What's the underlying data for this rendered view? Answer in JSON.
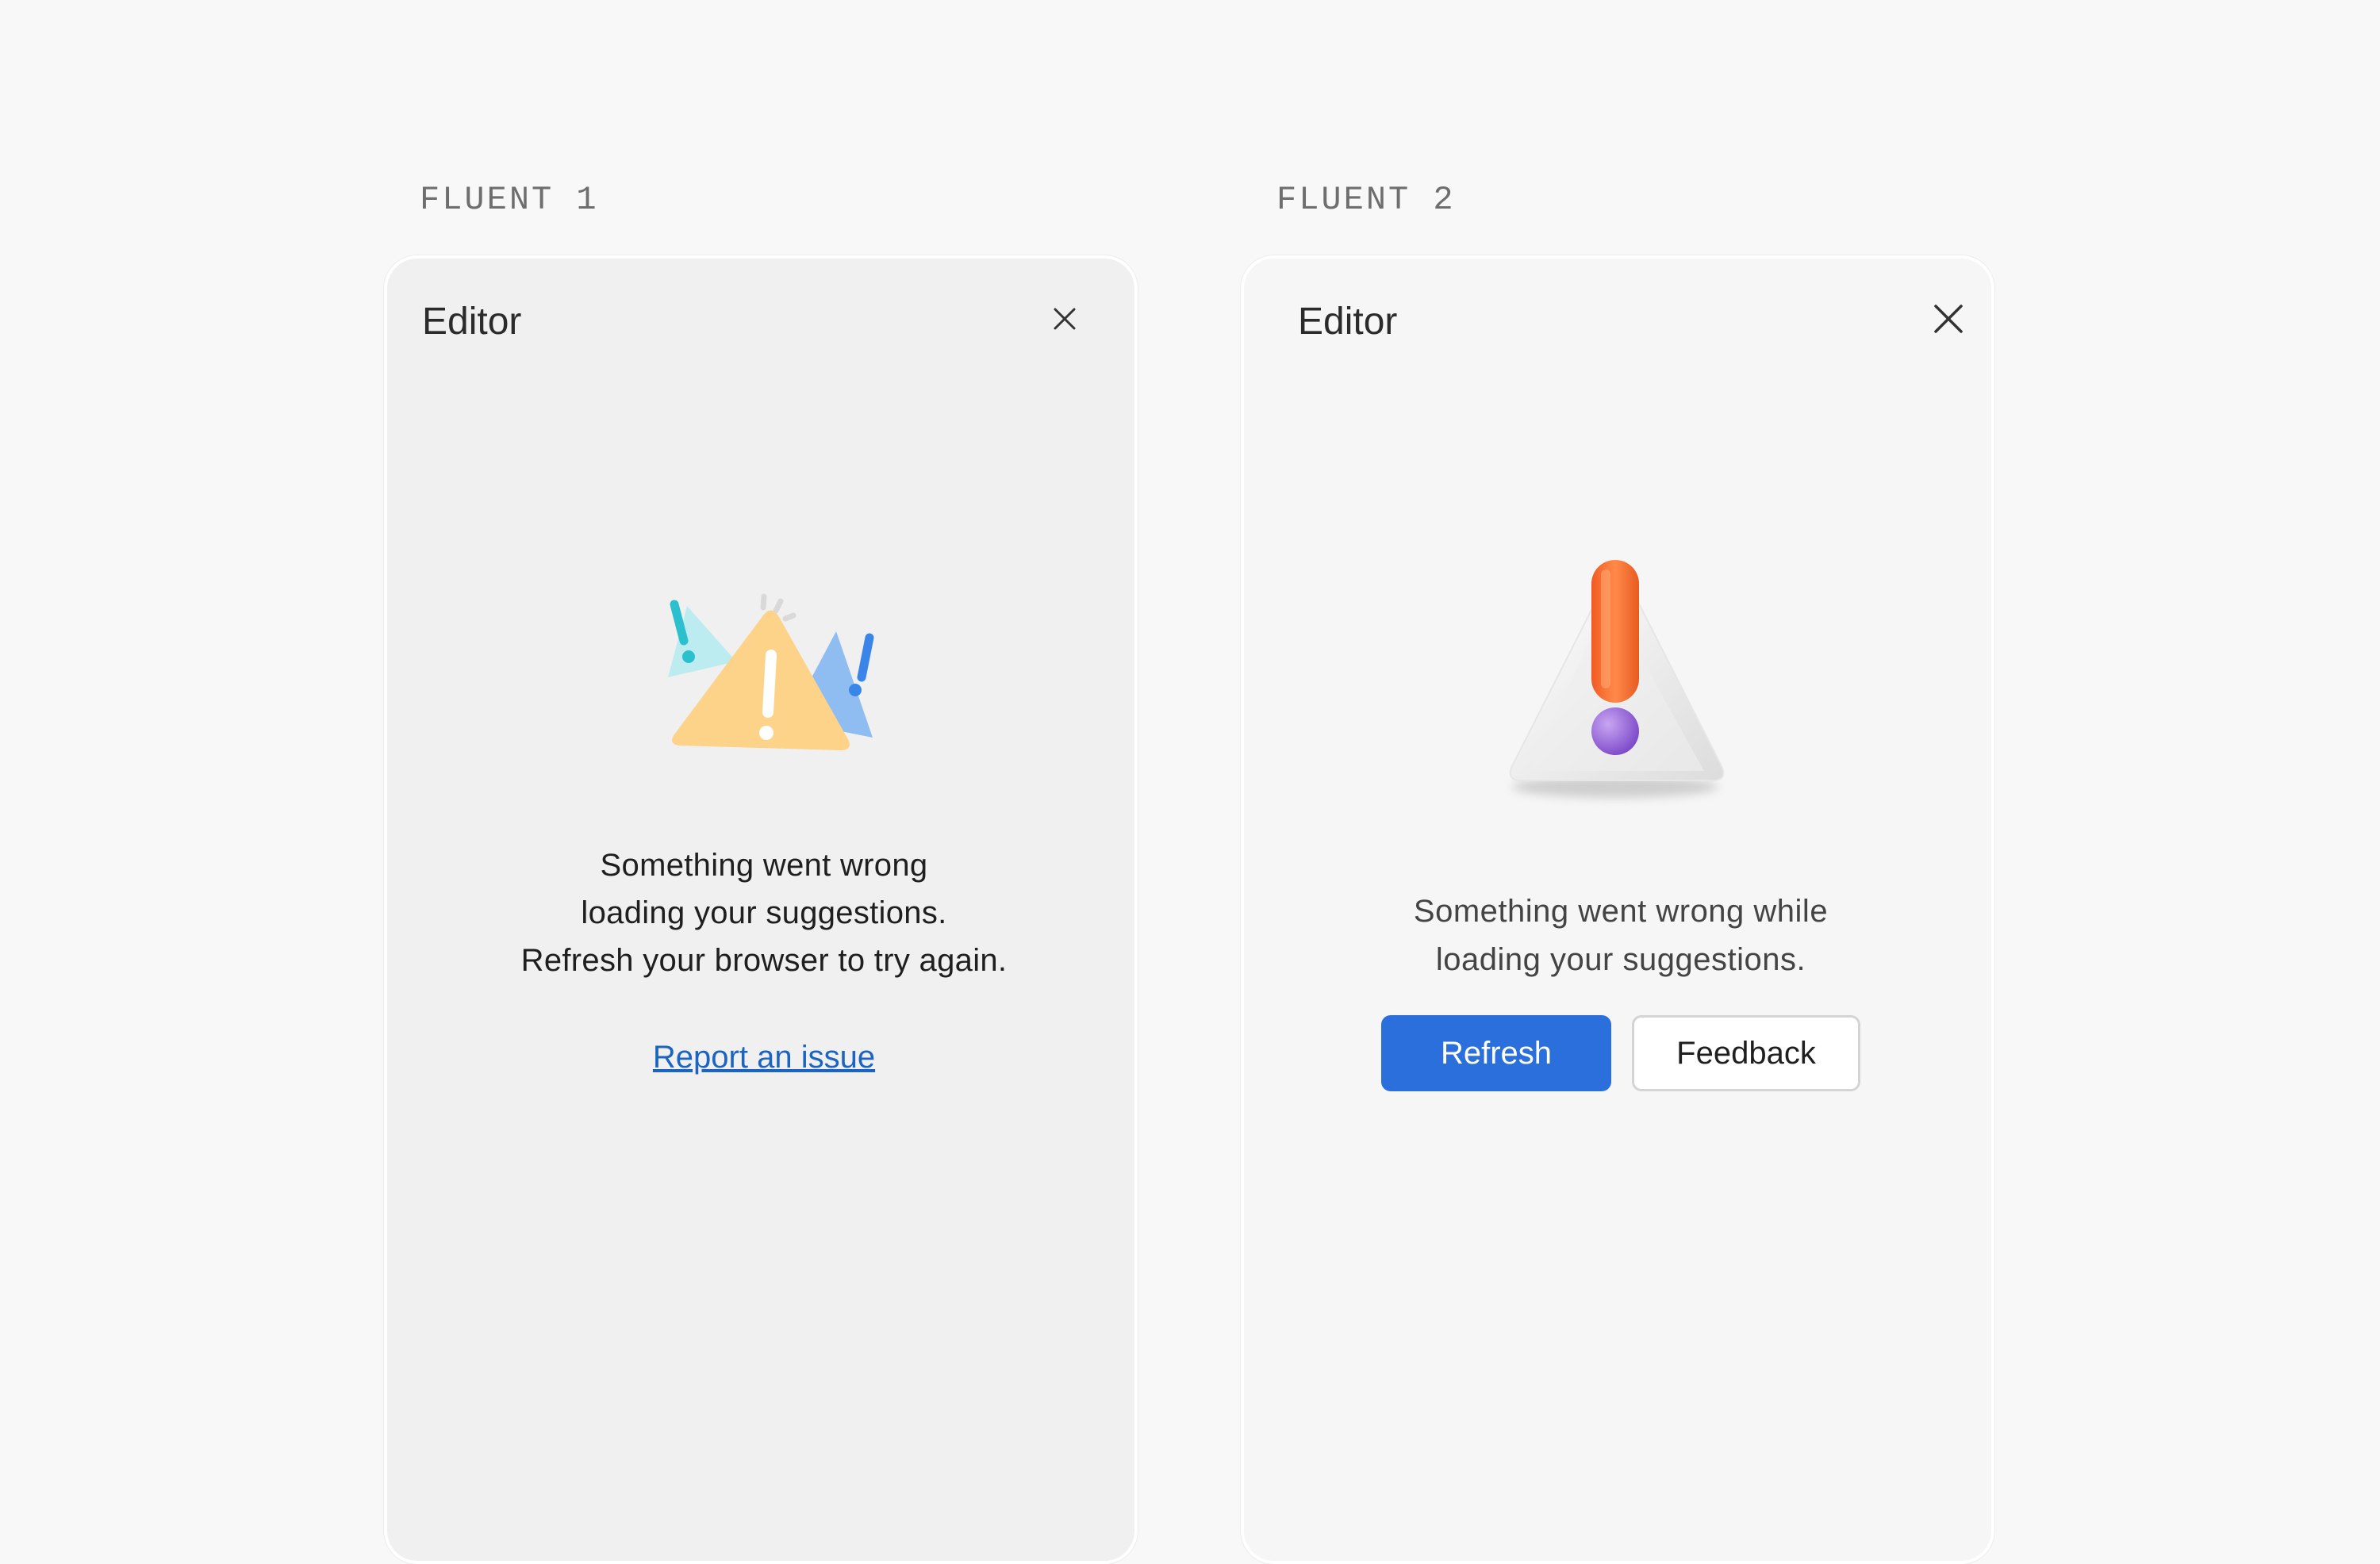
{
  "fluent1": {
    "section_label": "FLUENT 1",
    "panel_title": "Editor",
    "message": "Something went wrong\nloading your suggestions.\nRefresh your browser to try again.",
    "link_label": "Report an issue",
    "icons": {
      "close": "close-icon",
      "illustration": "warning-triangles-illustration"
    },
    "colors": {
      "warning": "#fdd289",
      "accent_teal": "#2cc0cf",
      "accent_blue": "#3a86e8",
      "link": "#1b64c2"
    }
  },
  "fluent2": {
    "section_label": "FLUENT 2",
    "panel_title": "Editor",
    "message": "Something went wrong while\nloading your suggestions.",
    "primary_button": "Refresh",
    "secondary_button": "Feedback",
    "icons": {
      "close": "close-icon",
      "illustration": "3d-warning-triangle-illustration"
    },
    "colors": {
      "primary": "#2a6fdc",
      "exclamation": "#f06a2a",
      "dot": "#9b6ad6"
    }
  }
}
